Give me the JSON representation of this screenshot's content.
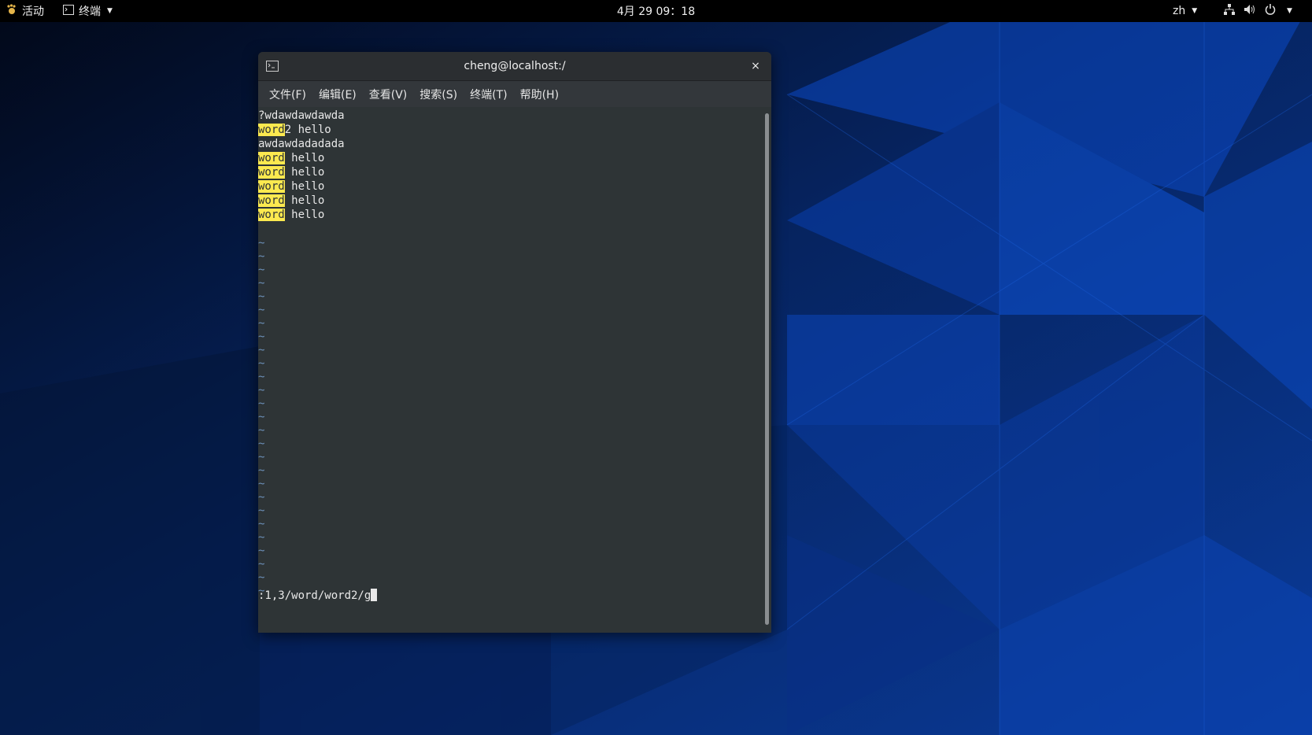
{
  "topbar": {
    "activities_label": "活动",
    "app_menu_label": "终端",
    "clock": "4月 29 09：18",
    "language": "zh"
  },
  "window": {
    "title": "cheng@localhost:/",
    "close_glyph": "×",
    "menus": [
      "文件(F)",
      "编辑(E)",
      "查看(V)",
      "搜索(S)",
      "终端(T)",
      "帮助(H)"
    ]
  },
  "terminal": {
    "lines": [
      {
        "hl": "",
        "rest": "?wdawdawdawda"
      },
      {
        "hl": "word",
        "rest": "2 hello"
      },
      {
        "hl": "",
        "rest": "awdawdadadada"
      },
      {
        "hl": "word",
        "rest": " hello"
      },
      {
        "hl": "word",
        "rest": " hello"
      },
      {
        "hl": "word",
        "rest": " hello"
      },
      {
        "hl": "word",
        "rest": " hello"
      },
      {
        "hl": "word",
        "rest": " hello"
      }
    ],
    "tilde_glyph": "~",
    "tilde_count": 27,
    "command": ":1,3/word/word2/g"
  },
  "icons": {
    "activities": "gnome-foot-icon",
    "app_menu": "terminal-icon",
    "network": "network-icon",
    "volume": "volume-icon",
    "power": "power-icon"
  },
  "colors": {
    "search_highlight": "#fce94f",
    "terminal_bg": "#2e3436",
    "tilde": "#6b8fb8"
  }
}
